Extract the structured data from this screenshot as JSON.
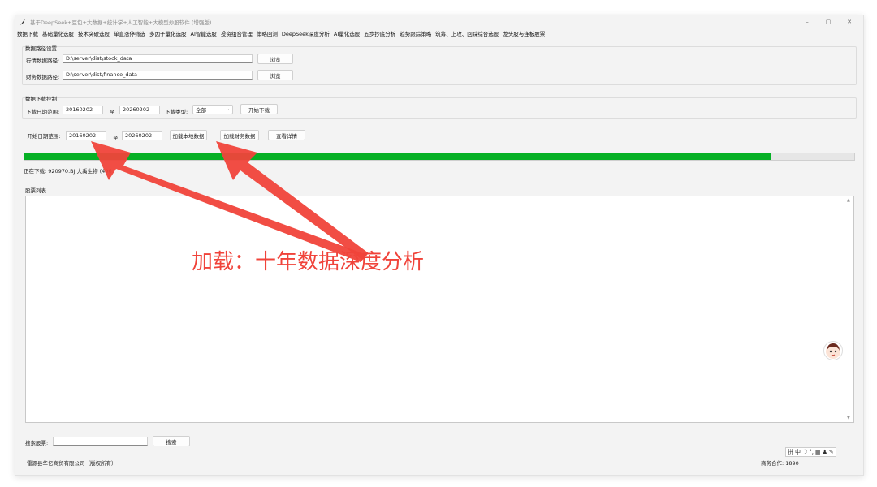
{
  "window": {
    "title": "基于DeepSeek+豆包+大数据+统计学+人工智能+大模型炒股软件 (增强版)",
    "controls": {
      "minimize": "–",
      "maximize": "▢",
      "close": "✕"
    }
  },
  "menu": [
    "数据下载",
    "基础量化选股",
    "技术突破选股",
    "单直涨停筛选",
    "多因子量化选股",
    "AI智能选股",
    "投资组合管理",
    "策略回测",
    "DeepSeek深度分析",
    "AI量化选股",
    "五步抄底分析",
    "趋势跟踪策略",
    "筑筹、上攻、回踩综合选股",
    "龙头股与连板股票"
  ],
  "data_path": {
    "group_title": "数据路径设置",
    "market_label": "行情数据路径:",
    "market_value": "D:\\server\\dist\\stock_data",
    "finance_label": "财务数据路径:",
    "finance_value": "D:\\server\\dist\\finance_data",
    "browse_label": "浏览"
  },
  "download": {
    "group_title": "数据下载控制",
    "range_label": "下载日期范围:",
    "start": "20160202",
    "to": "至",
    "end": "20260202",
    "type_label": "下载类型:",
    "type_value": "全部",
    "start_button": "开始下载"
  },
  "load": {
    "start_label": "开始日期范围:",
    "start": "20160202",
    "to": "至",
    "end": "20260202",
    "load_local": "加载本地数据",
    "load_finance": "加载财务数据",
    "view_detail": "查看详情"
  },
  "progress": 0.9,
  "status_text": "正在下载: 920970.BJ 大禹生物 (496",
  "stock_list": {
    "title": "股票列表"
  },
  "annotation": {
    "text": "加载：十年数据深度分析",
    "color": "#f0433a"
  },
  "search": {
    "label": "搜索股票:",
    "value": "",
    "button": "搜索"
  },
  "footer": {
    "company": "雷源县华亿商贸有限公司（版权所有）",
    "contact": "商务合作: 1890"
  },
  "ime": [
    "拼",
    "中",
    "☽",
    "°,",
    "▦",
    "♟",
    "✎"
  ]
}
